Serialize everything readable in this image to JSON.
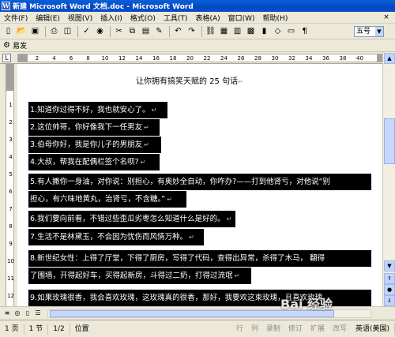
{
  "window": {
    "title": "新建 Microsoft Word 文档.doc - Microsoft Word"
  },
  "menu": {
    "items": [
      "文件(F)",
      "编辑(E)",
      "视图(V)",
      "插入(I)",
      "格式(O)",
      "工具(T)",
      "表格(A)",
      "窗口(W)",
      "帮助(H)"
    ],
    "close_label": "×"
  },
  "toolbar": {
    "font_size": "五号"
  },
  "ime": {
    "label": "易发"
  },
  "ruler": {
    "corner": "L",
    "ticks": [
      "2",
      "4",
      "6",
      "8",
      "10",
      "12",
      "14",
      "16",
      "18",
      "20",
      "22",
      "24",
      "26",
      "28",
      "30",
      "32",
      "34",
      "36",
      "38",
      "40"
    ],
    "vticks": [
      "1",
      "2",
      "3",
      "4",
      "5",
      "6",
      "7",
      "8",
      "9",
      "10",
      "11",
      "12"
    ]
  },
  "document": {
    "title": "让你拥有搞笑天赋的 25 句话",
    "para_mark": "↵",
    "lines": [
      "1.知道你过得不好，我也就安心了。",
      "2.这位帅哥，你好像我下一任男友",
      "3.伯母你好，我是你儿子的男朋友",
      "4.大叔，帮我在配偶栏签个名呗?",
      "5.有人撒你一身油，对你说：别担心，有奥妙全自动，你咋办?——打到他肾亏，对他说“别",
      "担心，有六味地黄丸，治肾亏，不含糖。”",
      "6.我们要向前看，不错过些歪瓜劣枣怎么知道什么是好的。",
      "7.生活不是林黛玉，不会因为忧伤而风情万种。",
      "8.新世纪女性：上得了厅堂，下得了厨房，写得了代码，查得出异常，杀得了木马，  翻得",
      "了围墙，开得起好车，买得起新房，斗得过二奶，打得过流氓",
      "9.如果玫瑰很香，我会喜欢玫瑰，这玫瑰真的很香，那好，我要欢这束玫瑰，且喜欢玫瑰"
    ]
  },
  "status": {
    "page": "1 页",
    "section": "1 节",
    "page_of": "1/2",
    "position": "位置",
    "line": "行",
    "column": "列",
    "rec": "录制",
    "trk": "修订",
    "ext": "扩展",
    "ovr": "改写",
    "language": "英语(美国)"
  },
  "watermark": {
    "text": "Bai 经验"
  },
  "colors": {
    "titlebar": "#0a5fd8",
    "chrome": "#ece9d8",
    "selection": "#000000"
  }
}
